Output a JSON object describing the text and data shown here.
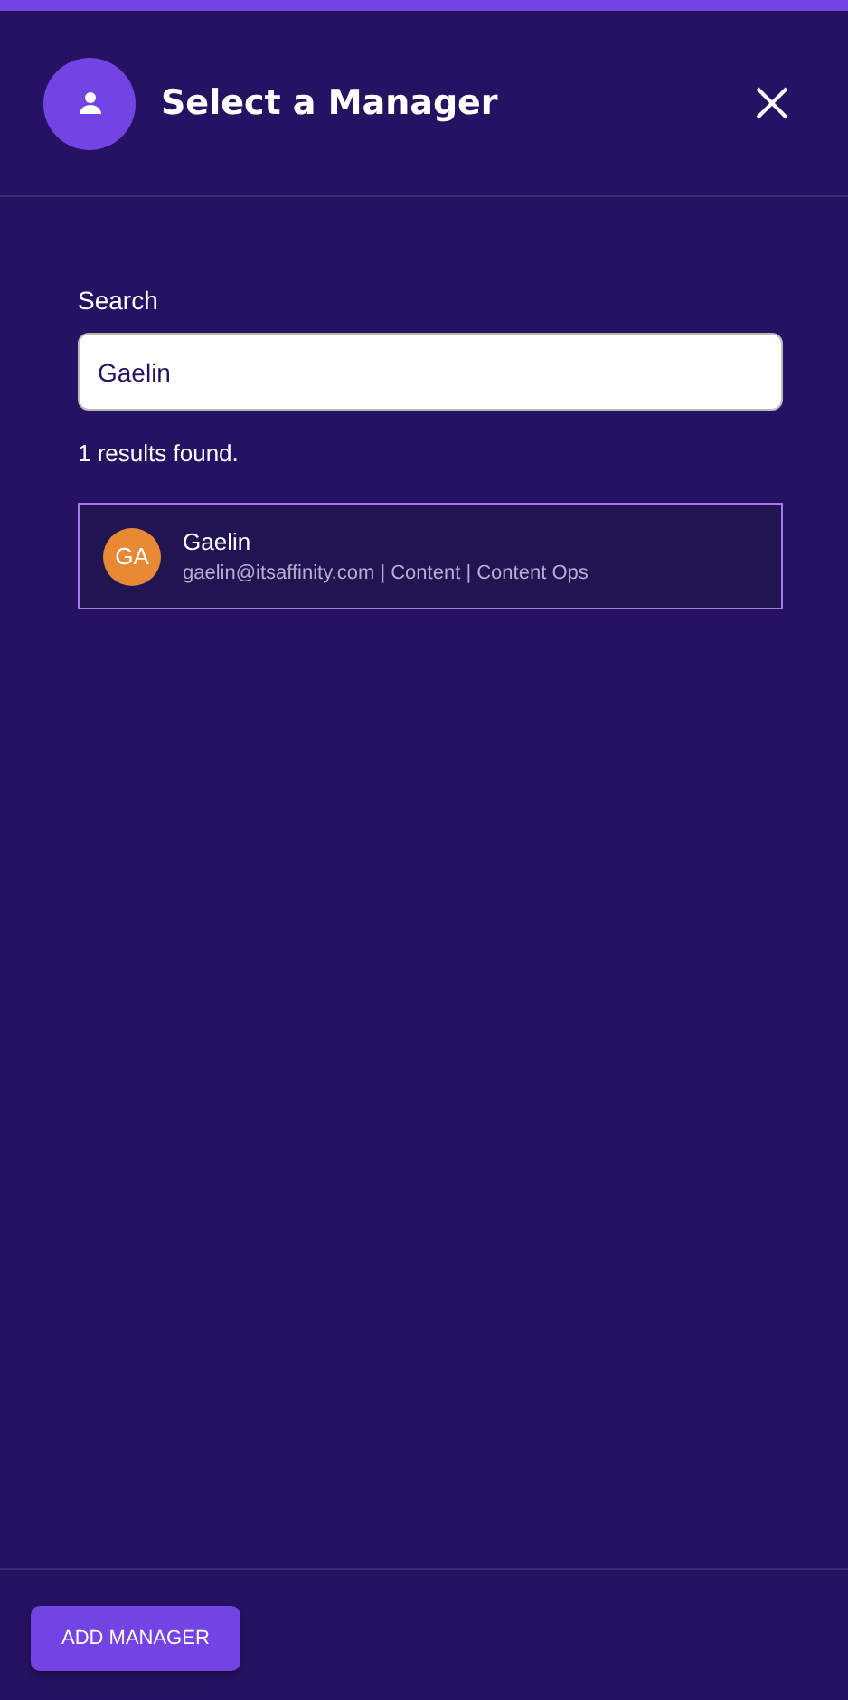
{
  "dialog": {
    "title": "Select a Manager"
  },
  "search": {
    "label": "Search",
    "value": "Gaelin"
  },
  "results_count": "1 results found.",
  "results": [
    {
      "initials": "GA",
      "name": "Gaelin",
      "details": "gaelin@itsaffinity.com | Content | Content Ops",
      "selected": true,
      "color": "#e88a35"
    }
  ],
  "footer": {
    "button": "ADD MANAGER"
  }
}
